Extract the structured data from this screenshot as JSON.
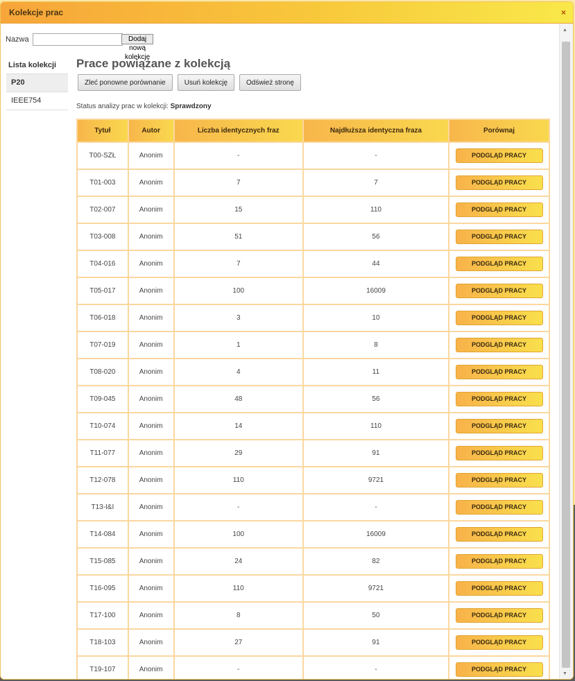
{
  "dialog": {
    "title": "Kolekcje prac",
    "close_icon": "×"
  },
  "add_collection": {
    "label": "Nazwa",
    "value": "",
    "button": "Dodaj nową kolekcję"
  },
  "sidebar": {
    "heading": "Lista kolekcji",
    "items": [
      {
        "label": "P20",
        "active": true
      },
      {
        "label": "IEEE754",
        "active": false
      }
    ]
  },
  "main": {
    "heading": "Prace powiązane z kolekcją",
    "buttons": {
      "rerun": "Zleć ponowne porównanie",
      "delete": "Usuń kolekcję",
      "refresh": "Odśwież stronę"
    },
    "status_label": "Status analizy prac w kolekcji:",
    "status_value": "Sprawdzony"
  },
  "table": {
    "headers": [
      "Tytuł",
      "Autor",
      "Liczba identycznych fraz",
      "Najdłuższa identyczna fraza",
      "Porównaj"
    ],
    "action_label": "PODGLĄD PRACY",
    "rows": [
      [
        "T00-SZŁ",
        "Anonim",
        "-",
        "-"
      ],
      [
        "T01-003",
        "Anonim",
        "7",
        "7"
      ],
      [
        "T02-007",
        "Anonim",
        "15",
        "110"
      ],
      [
        "T03-008",
        "Anonim",
        "51",
        "56"
      ],
      [
        "T04-016",
        "Anonim",
        "7",
        "44"
      ],
      [
        "T05-017",
        "Anonim",
        "100",
        "16009"
      ],
      [
        "T06-018",
        "Anonim",
        "3",
        "10"
      ],
      [
        "T07-019",
        "Anonim",
        "1",
        "8"
      ],
      [
        "T08-020",
        "Anonim",
        "4",
        "11"
      ],
      [
        "T09-045",
        "Anonim",
        "48",
        "56"
      ],
      [
        "T10-074",
        "Anonim",
        "14",
        "110"
      ],
      [
        "T11-077",
        "Anonim",
        "29",
        "91"
      ],
      [
        "T12-078",
        "Anonim",
        "110",
        "9721"
      ],
      [
        "T13-I&I",
        "Anonim",
        "-",
        "-"
      ],
      [
        "T14-084",
        "Anonim",
        "100",
        "16009"
      ],
      [
        "T15-085",
        "Anonim",
        "24",
        "82"
      ],
      [
        "T16-095",
        "Anonim",
        "110",
        "9721"
      ],
      [
        "T17-100",
        "Anonim",
        "8",
        "50"
      ],
      [
        "T18-103",
        "Anonim",
        "27",
        "91"
      ],
      [
        "T19-107",
        "Anonim",
        "-",
        "-"
      ]
    ]
  },
  "scrollbar": {
    "up_icon": "▲",
    "down_icon": "▼"
  },
  "colors": {
    "accent_start": "#f8b24a",
    "accent_end": "#f9e04c",
    "border": "#fbd79e"
  }
}
